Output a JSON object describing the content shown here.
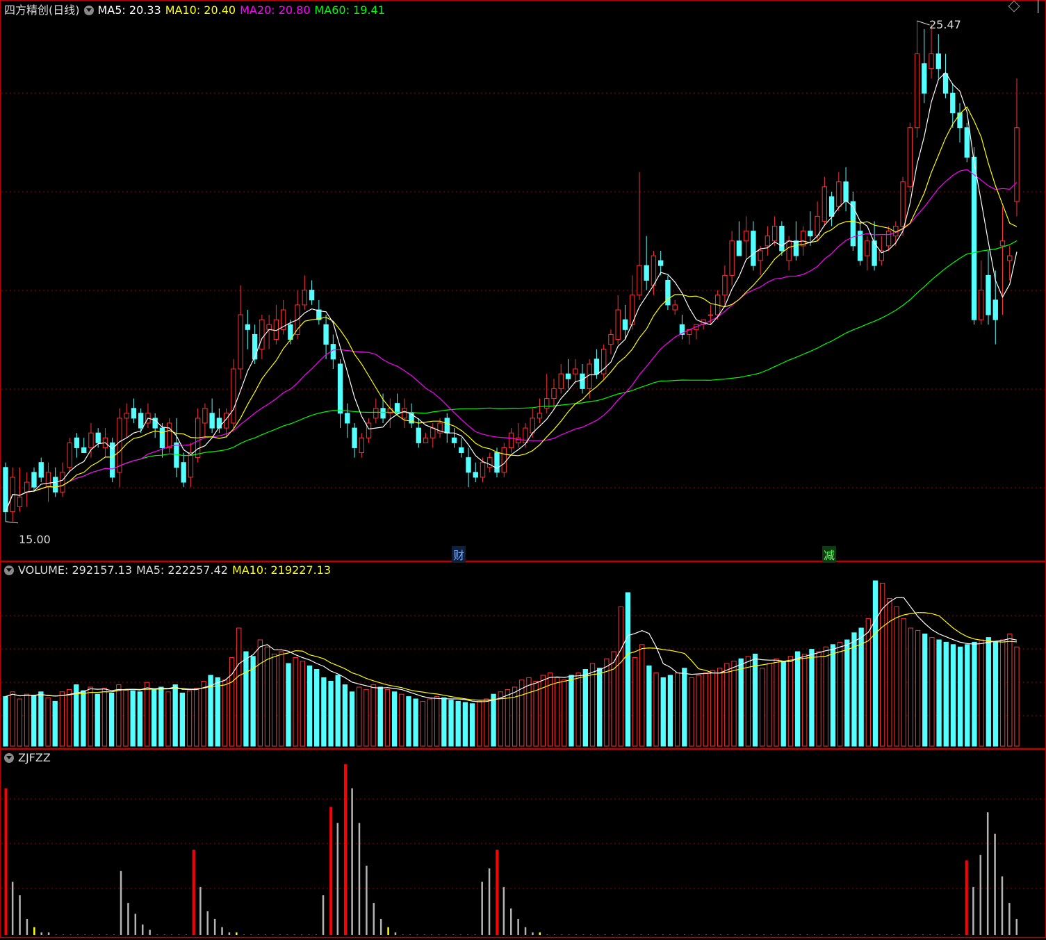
{
  "colors": {
    "up": "#ff3232",
    "down": "#54ffff",
    "ma5": "#ffffff",
    "ma10": "#ffff00",
    "ma20": "#ff00ff",
    "ma60": "#00ff00",
    "grid": "#a00000",
    "frame": "#c00000",
    "zj_gray": "#b4b4b4",
    "zj_red": "#ff0000",
    "zj_yellow": "#ffff00"
  },
  "price_panel": {
    "title": "四方精创(日线)",
    "ma5_label": "MA5: 20.33",
    "ma10_label": "MA10: 20.40",
    "ma20_label": "MA20: 20.80",
    "ma60_label": "MA60: 19.41",
    "high_label": "25.47",
    "low_label": "15.00",
    "marker_cai": "财",
    "marker_jian": "减",
    "menu_icon": "diamond-icon"
  },
  "volume_panel": {
    "volume_label": "VOLUME: 292157.13",
    "ma5_label": "MA5: 222257.42",
    "ma10_label": "MA10: 219227.13"
  },
  "zjfzz_panel": {
    "title": "ZJFZZ"
  },
  "chart_data": [
    {
      "type": "candlestick",
      "title": "四方精创(日线)",
      "ylim": [
        15.0,
        25.47
      ],
      "grid": true,
      "ohlc": [
        [
          16.4,
          16.5,
          15.3,
          15.5
        ],
        [
          15.5,
          16.4,
          15.3,
          16.2
        ],
        [
          15.6,
          16.4,
          15.5,
          15.8
        ],
        [
          15.9,
          16.3,
          15.6,
          16.1
        ],
        [
          16.3,
          16.4,
          15.9,
          16.0
        ],
        [
          16.5,
          16.6,
          16.1,
          16.2
        ],
        [
          16.0,
          16.5,
          15.7,
          16.3
        ],
        [
          16.2,
          16.4,
          15.8,
          15.9
        ],
        [
          15.9,
          16.5,
          15.8,
          16.3
        ],
        [
          16.4,
          17.0,
          16.3,
          16.9
        ],
        [
          17.0,
          17.1,
          16.6,
          16.8
        ],
        [
          16.8,
          17.0,
          16.7,
          16.7
        ],
        [
          16.8,
          17.3,
          16.6,
          17.1
        ],
        [
          17.1,
          17.2,
          16.8,
          16.9
        ],
        [
          16.8,
          17.2,
          16.6,
          17.0
        ],
        [
          16.9,
          17.0,
          16.1,
          16.2
        ],
        [
          16.3,
          17.6,
          16.0,
          17.4
        ],
        [
          17.4,
          17.7,
          17.0,
          17.5
        ],
        [
          17.6,
          17.8,
          17.3,
          17.4
        ],
        [
          17.5,
          17.6,
          17.1,
          17.2
        ],
        [
          17.3,
          17.7,
          17.2,
          17.5
        ],
        [
          17.4,
          17.5,
          17.0,
          17.2
        ],
        [
          17.2,
          17.3,
          16.6,
          16.8
        ],
        [
          16.8,
          17.4,
          16.7,
          17.3
        ],
        [
          16.9,
          17.4,
          16.2,
          16.4
        ],
        [
          16.5,
          16.7,
          16.0,
          16.1
        ],
        [
          16.2,
          16.9,
          16.0,
          16.7
        ],
        [
          16.6,
          17.6,
          16.5,
          17.4
        ],
        [
          17.3,
          17.7,
          17.0,
          17.6
        ],
        [
          17.5,
          17.8,
          17.1,
          17.2
        ],
        [
          17.4,
          17.6,
          17.1,
          17.2
        ],
        [
          17.2,
          17.6,
          17.0,
          17.5
        ],
        [
          17.3,
          18.6,
          17.2,
          18.4
        ],
        [
          18.4,
          20.1,
          18.2,
          19.5
        ],
        [
          19.3,
          19.6,
          18.8,
          19.2
        ],
        [
          19.1,
          19.3,
          18.5,
          18.6
        ],
        [
          18.8,
          19.5,
          18.6,
          19.4
        ],
        [
          19.2,
          19.5,
          18.8,
          19.3
        ],
        [
          19.0,
          19.7,
          18.9,
          19.4
        ],
        [
          19.2,
          19.8,
          19.1,
          19.6
        ],
        [
          19.3,
          19.4,
          18.9,
          19.0
        ],
        [
          19.1,
          20.0,
          19.0,
          19.7
        ],
        [
          19.7,
          20.3,
          19.6,
          20.0
        ],
        [
          20.0,
          20.2,
          19.7,
          19.8
        ],
        [
          19.6,
          19.8,
          19.3,
          19.4
        ],
        [
          19.3,
          19.5,
          18.6,
          18.9
        ],
        [
          18.9,
          19.1,
          18.4,
          18.6
        ],
        [
          18.5,
          18.6,
          17.2,
          17.5
        ],
        [
          17.5,
          17.7,
          17.0,
          17.3
        ],
        [
          17.2,
          17.3,
          16.6,
          16.8
        ],
        [
          16.7,
          17.1,
          16.6,
          17.0
        ],
        [
          17.0,
          17.4,
          16.9,
          17.3
        ],
        [
          17.4,
          17.8,
          17.3,
          17.6
        ],
        [
          17.6,
          17.9,
          17.3,
          17.4
        ],
        [
          17.5,
          17.8,
          17.2,
          17.6
        ],
        [
          17.7,
          17.9,
          17.5,
          17.5
        ],
        [
          17.4,
          17.8,
          17.2,
          17.6
        ],
        [
          17.5,
          17.7,
          17.2,
          17.3
        ],
        [
          17.2,
          17.4,
          16.8,
          16.9
        ],
        [
          16.9,
          17.1,
          16.9,
          17.0
        ],
        [
          17.0,
          17.3,
          16.8,
          17.2
        ],
        [
          17.1,
          17.4,
          17.0,
          17.3
        ],
        [
          17.4,
          17.5,
          16.9,
          17.1
        ],
        [
          17.0,
          17.2,
          16.8,
          16.9
        ],
        [
          16.8,
          17.0,
          16.6,
          16.7
        ],
        [
          16.6,
          16.8,
          16.0,
          16.3
        ],
        [
          16.3,
          16.5,
          16.1,
          16.2
        ],
        [
          16.2,
          16.6,
          16.1,
          16.5
        ],
        [
          16.4,
          16.7,
          16.3,
          16.6
        ],
        [
          16.7,
          16.8,
          16.2,
          16.3
        ],
        [
          16.3,
          16.9,
          16.2,
          16.8
        ],
        [
          16.8,
          17.2,
          16.7,
          17.1
        ],
        [
          16.9,
          17.3,
          16.8,
          17.0
        ],
        [
          16.9,
          17.3,
          16.8,
          17.2
        ],
        [
          17.1,
          17.6,
          17.0,
          17.4
        ],
        [
          17.4,
          17.8,
          17.3,
          17.5
        ],
        [
          17.6,
          18.3,
          17.5,
          17.8
        ],
        [
          17.8,
          18.2,
          17.6,
          18.0
        ],
        [
          18.0,
          18.5,
          17.9,
          18.3
        ],
        [
          18.3,
          18.6,
          18.0,
          18.2
        ],
        [
          18.3,
          18.6,
          18.1,
          18.4
        ],
        [
          18.3,
          18.5,
          17.9,
          18.0
        ],
        [
          18.0,
          18.6,
          17.8,
          18.5
        ],
        [
          18.6,
          18.8,
          18.2,
          18.3
        ],
        [
          18.3,
          18.9,
          18.2,
          18.8
        ],
        [
          18.9,
          19.2,
          18.7,
          19.1
        ],
        [
          19.0,
          19.9,
          18.9,
          19.6
        ],
        [
          19.4,
          19.7,
          19.0,
          19.2
        ],
        [
          19.3,
          20.3,
          19.2,
          19.9
        ],
        [
          19.9,
          22.4,
          19.8,
          20.5
        ],
        [
          20.5,
          21.1,
          20.0,
          20.2
        ],
        [
          20.1,
          20.8,
          19.9,
          20.7
        ],
        [
          20.6,
          20.8,
          20.3,
          20.5
        ],
        [
          20.2,
          20.3,
          19.6,
          19.7
        ],
        [
          19.6,
          19.8,
          19.5,
          19.7
        ],
        [
          19.3,
          19.5,
          19.0,
          19.1
        ],
        [
          19.1,
          19.2,
          18.9,
          19.2
        ],
        [
          19.2,
          19.3,
          19.0,
          19.3
        ],
        [
          19.3,
          19.4,
          19.2,
          19.4
        ],
        [
          19.5,
          19.7,
          19.3,
          19.5
        ],
        [
          19.5,
          20.0,
          19.4,
          19.9
        ],
        [
          19.9,
          20.5,
          19.7,
          20.3
        ],
        [
          20.3,
          21.2,
          20.1,
          21.0
        ],
        [
          21.0,
          21.4,
          20.8,
          20.7
        ],
        [
          21.0,
          21.5,
          20.6,
          21.2
        ],
        [
          21.2,
          21.4,
          20.4,
          20.5
        ],
        [
          20.6,
          20.9,
          20.3,
          20.8
        ],
        [
          20.9,
          21.3,
          20.7,
          21.1
        ],
        [
          21.0,
          21.5,
          20.9,
          21.3
        ],
        [
          21.3,
          21.4,
          20.7,
          20.8
        ],
        [
          20.6,
          21.1,
          20.4,
          21.0
        ],
        [
          21.0,
          21.4,
          20.6,
          20.7
        ],
        [
          20.9,
          21.3,
          20.7,
          21.2
        ],
        [
          21.2,
          21.6,
          20.9,
          21.1
        ],
        [
          21.1,
          21.8,
          21.0,
          21.5
        ],
        [
          21.4,
          22.3,
          21.3,
          22.1
        ],
        [
          21.9,
          22.0,
          21.3,
          21.5
        ],
        [
          21.7,
          22.4,
          21.6,
          22.2
        ],
        [
          22.2,
          22.5,
          21.6,
          21.8
        ],
        [
          21.8,
          22.0,
          20.8,
          20.9
        ],
        [
          21.2,
          21.4,
          20.5,
          20.6
        ],
        [
          20.7,
          21.1,
          20.4,
          21.0
        ],
        [
          21.0,
          21.4,
          20.4,
          20.5
        ],
        [
          20.6,
          21.1,
          20.5,
          20.8
        ],
        [
          20.9,
          21.3,
          20.8,
          21.2
        ],
        [
          21.1,
          21.4,
          20.9,
          21.3
        ],
        [
          21.3,
          22.3,
          21.1,
          22.2
        ],
        [
          22.1,
          23.4,
          22.0,
          23.3
        ],
        [
          23.3,
          25.47,
          23.1,
          24.8
        ],
        [
          24.6,
          25.3,
          23.8,
          24.0
        ],
        [
          24.5,
          25.4,
          24.3,
          24.8
        ],
        [
          24.8,
          25.2,
          24.3,
          24.5
        ],
        [
          24.4,
          24.8,
          23.9,
          24.0
        ],
        [
          24.0,
          24.2,
          23.3,
          23.6
        ],
        [
          23.6,
          23.8,
          23.0,
          23.3
        ],
        [
          23.3,
          23.4,
          22.6,
          22.7
        ],
        [
          22.7,
          22.9,
          19.3,
          19.4
        ],
        [
          19.4,
          20.6,
          19.3,
          20.0
        ],
        [
          20.3,
          20.8,
          19.3,
          19.5
        ],
        [
          19.8,
          20.4,
          18.9,
          19.4
        ],
        [
          20.9,
          21.7,
          19.5,
          21.0
        ],
        [
          20.6,
          20.9,
          20.2,
          20.7
        ],
        [
          21.8,
          24.3,
          21.5,
          23.3
        ]
      ]
    },
    {
      "type": "bar",
      "title": "VOLUME",
      "values": [
        42,
        46,
        40,
        44,
        43,
        46,
        41,
        38,
        46,
        48,
        52,
        47,
        50,
        44,
        49,
        45,
        52,
        48,
        47,
        46,
        54,
        48,
        50,
        46,
        52,
        45,
        47,
        49,
        55,
        60,
        58,
        56,
        75,
        100,
        80,
        76,
        90,
        84,
        78,
        80,
        70,
        75,
        72,
        68,
        65,
        58,
        55,
        60,
        52,
        46,
        50,
        48,
        52,
        50,
        48,
        46,
        44,
        42,
        40,
        38,
        40,
        42,
        41,
        39,
        38,
        37,
        36,
        38,
        40,
        44,
        46,
        48,
        50,
        56,
        58,
        55,
        60,
        62,
        58,
        56,
        60,
        62,
        65,
        70,
        66,
        74,
        80,
        118,
        130,
        75,
        86,
        68,
        62,
        58,
        60,
        62,
        66,
        58,
        60,
        62,
        64,
        66,
        70,
        72,
        74,
        76,
        78,
        66,
        70,
        74,
        72,
        76,
        80,
        78,
        82,
        80,
        84,
        86,
        88,
        90,
        96,
        100,
        108,
        140,
        138,
        125,
        118,
        108,
        100,
        98,
        95,
        92,
        90,
        88,
        86,
        84,
        86,
        88,
        90,
        92,
        88,
        90,
        95,
        84
      ],
      "ma5_label": "MA5: 222257.42",
      "ma10_label": "MA10: 219227.13"
    },
    {
      "type": "bar",
      "title": "ZJFZZ",
      "values": [
        55,
        20,
        15,
        6,
        3,
        1,
        1,
        0,
        0,
        0,
        0,
        0,
        0,
        0,
        0,
        0,
        24,
        12,
        8,
        4,
        2,
        0,
        0,
        0,
        0,
        0,
        32,
        18,
        9,
        6,
        3,
        1,
        1,
        0,
        0,
        0,
        0,
        0,
        0,
        0,
        0,
        0,
        0,
        0,
        15,
        48,
        42,
        64,
        55,
        42,
        26,
        12,
        6,
        3,
        1,
        0,
        0,
        0,
        0,
        0,
        0,
        0,
        0,
        0,
        0,
        0,
        20,
        25,
        32,
        18,
        10,
        6,
        3,
        1,
        1,
        0,
        0,
        0,
        0,
        0,
        0,
        0,
        0,
        0,
        0,
        0,
        0,
        0,
        0,
        0,
        0,
        0,
        0,
        0,
        0,
        0,
        0,
        0,
        0,
        0,
        0,
        0,
        0,
        0,
        0,
        0,
        0,
        0,
        0,
        0,
        0,
        0,
        0,
        0,
        0,
        0,
        0,
        0,
        0,
        0,
        0,
        0,
        0,
        0,
        0,
        0,
        0,
        0,
        0,
        0,
        0,
        0,
        0,
        28,
        18,
        30,
        46,
        38,
        22,
        12,
        6
      ]
    }
  ]
}
